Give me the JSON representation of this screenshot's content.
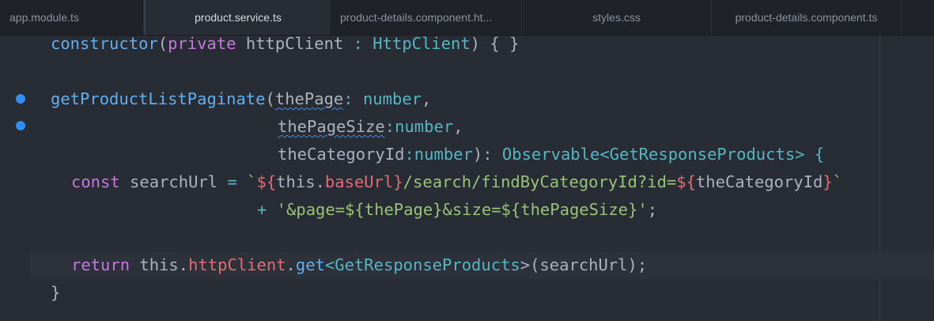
{
  "tabs": [
    {
      "label": "app.module.ts",
      "active": false
    },
    {
      "label": "product.service.ts",
      "active": true
    },
    {
      "label": "product-details.component.ht...",
      "active": false
    },
    {
      "label": "styles.css",
      "active": false
    },
    {
      "label": "product-details.component.ts",
      "active": false
    }
  ],
  "code": {
    "l1": {
      "kw": "constructor",
      "p1": "(",
      "kw2": "private",
      "p2": " httpClient ",
      "p3": ":",
      "ty": " HttpClient",
      "p4": ") { }"
    },
    "l2": {
      "fn": "getProductListPaginate",
      "p1": "(",
      "param": "thePage",
      "p2": ": ",
      "ty": "number",
      "p3": ","
    },
    "l3": {
      "param": "thePageSize",
      "p2": ":",
      "ty": "number",
      "p3": ","
    },
    "l4": {
      "param": "theCategoryId",
      "p2": ":",
      "ty": "number",
      "p3": "): ",
      "ty2": "Observable",
      "p4": "<",
      "ty3": "GetResponseProducts",
      "p5": "> {"
    },
    "l5": {
      "kw": "const",
      "p1": " searchUrl ",
      "op": "=",
      "s1": " `",
      "i1": "${",
      "p2": "this",
      "p3": ".",
      "prop": "baseUrl",
      "i2": "}",
      "s2": "/search/findByCategoryId?id=",
      "i3": "${",
      "p4": "theCategoryId",
      "i4": "}",
      "s3": "`"
    },
    "l6": {
      "op": "+",
      "s1": " '&page=${thePage}&size=${thePageSize}'",
      "p1": ";"
    },
    "l7": {
      "kw": "return",
      "p1": " this.",
      "prop": "httpClient",
      "p2": ".",
      "fn": "get",
      "p3": "<",
      "ty": "GetResponseProducts",
      "p4": ">(searchUrl);"
    },
    "l8": {
      "p1": "}"
    }
  },
  "colors": {
    "background": "#282c34",
    "keyword": "#c678dd",
    "function": "#61afef",
    "type": "#56b6c2",
    "string": "#98c379",
    "property": "#e06c75",
    "breakpoint": "#2f8ff5"
  }
}
